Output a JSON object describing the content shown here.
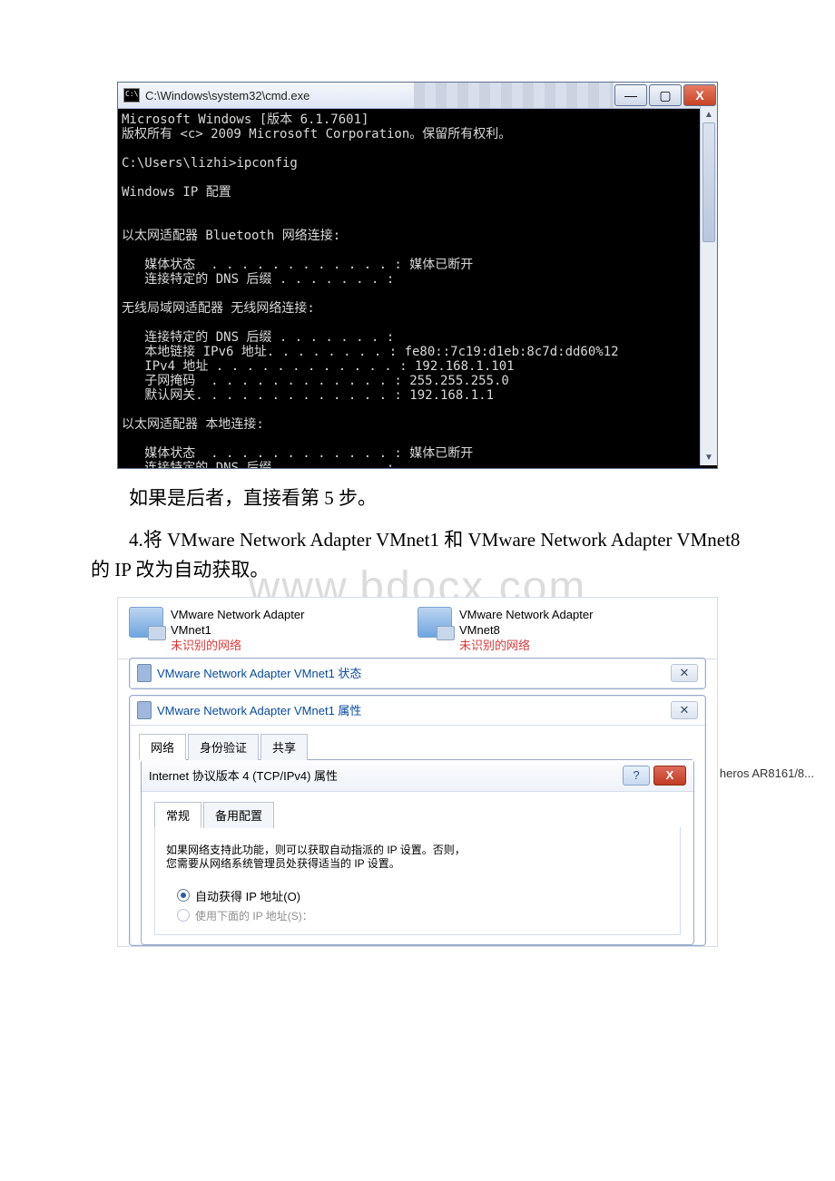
{
  "cmd": {
    "title": "C:\\Windows\\system32\\cmd.exe",
    "btn_min": "—",
    "btn_max": "▢",
    "btn_close": "X",
    "body": "Microsoft Windows [版本 6.1.7601]\n版权所有 <c> 2009 Microsoft Corporation。保留所有权利。\n\nC:\\Users\\lizhi>ipconfig\n\nWindows IP 配置\n\n\n以太网适配器 Bluetooth 网络连接:\n\n   媒体状态  . . . . . . . . . . . . : 媒体已断开\n   连接特定的 DNS 后缀 . . . . . . . :\n\n无线局域网适配器 无线网络连接:\n\n   连接特定的 DNS 后缀 . . . . . . . :\n   本地链接 IPv6 地址. . . . . . . . : fe80::7c19:d1eb:8c7d:dd60%12\n   IPv4 地址 . . . . . . . . . . . . : 192.168.1.101\n   子网掩码  . . . . . . . . . . . . : 255.255.255.0\n   默认网关. . . . . . . . . . . . . : 192.168.1.1\n\n以太网适配器 本地连接:\n\n   媒体状态  . . . . . . . . . . . . : 媒体已断开\n   连接特定的 DNS 后缀 . . . . . . . :"
  },
  "doc": {
    "line1": "如果是后者，直接看第 5 步。",
    "line2": "4.将 VMware Network Adapter VMnet1 和 VMware Network Adapter VMnet8 的 IP 改为自动获取。",
    "watermark": "www.bdocx.com"
  },
  "net": {
    "adapter1": {
      "name": "VMware Network Adapter",
      "sub": "VMnet1",
      "state": "未识别的网络"
    },
    "adapter2": {
      "name": "VMware Network Adapter",
      "sub": "VMnet8",
      "state": "未识别的网络"
    },
    "overlap_right": "heros AR8161/8...",
    "status_dialog": {
      "title": "VMware Network Adapter VMnet1 状态",
      "close": "✕"
    },
    "prop_dialog": {
      "title": "VMware Network Adapter VMnet1 属性",
      "close": "✕"
    },
    "tabs_outer": {
      "t1": "网络",
      "t2": "身份验证",
      "t3": "共享"
    },
    "ipv4_dialog": {
      "title": "Internet 协议版本 4 (TCP/IPv4) 属性",
      "help": "?",
      "close": "X",
      "tabs": {
        "t1": "常规",
        "t2": "备用配置"
      },
      "info": "如果网络支持此功能，则可以获取自动指派的 IP 设置。否则，\n您需要从网络系统管理员处获得适当的 IP 设置。",
      "radio_auto": "自动获得 IP 地址(O)",
      "radio_manual": "使用下面的 IP 地址(S)："
    }
  }
}
